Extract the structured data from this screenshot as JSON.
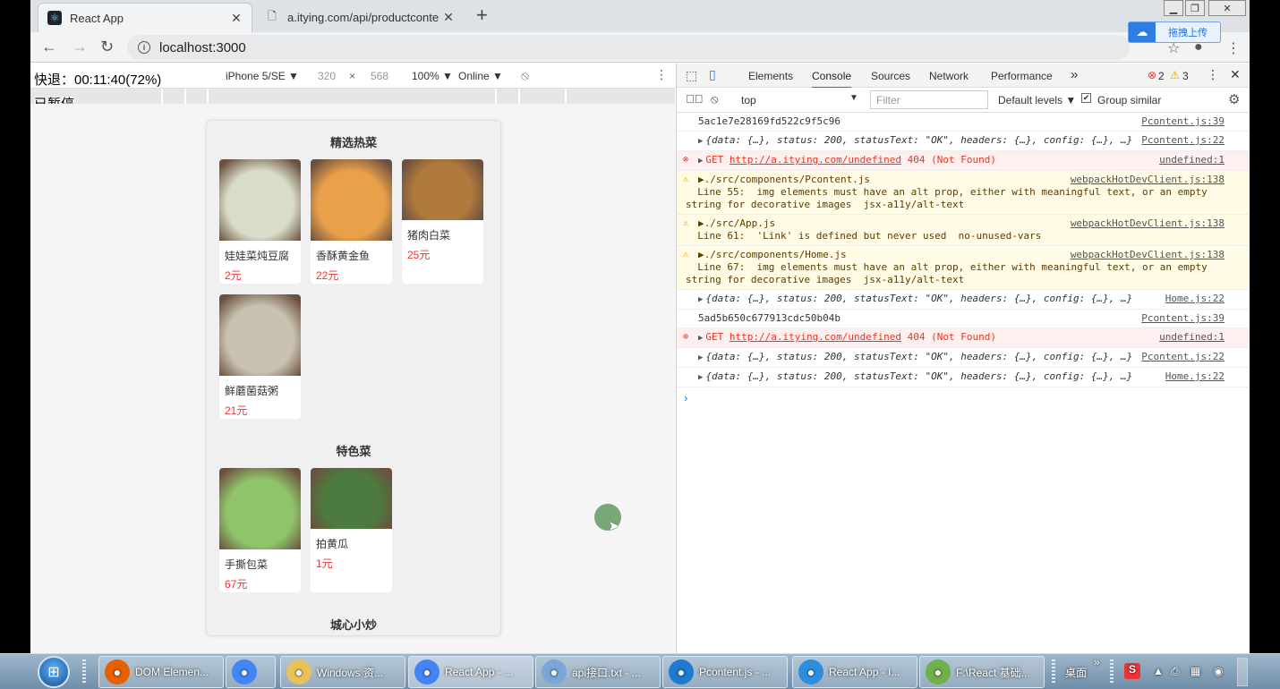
{
  "browser": {
    "tabs": [
      {
        "title": "React App",
        "favicon": "react-icon",
        "active": true
      },
      {
        "title": "a.itying.com/api/productconte",
        "favicon": "page-icon",
        "active": false
      }
    ],
    "url": "localhost:3000",
    "baidu_label": "拖拽上传"
  },
  "overlay": {
    "line1": "快退：00:11:40(72%)",
    "line2": "已暂停"
  },
  "device_toolbar": {
    "device": "iPhone 5/SE ▼",
    "width": "320",
    "times": "×",
    "height": "568",
    "zoom": "100% ▼",
    "network": "Online ▼"
  },
  "app": {
    "categories": [
      {
        "title": "精选热菜",
        "items": [
          {
            "name": "娃娃菜炖豆腐",
            "price": "2元",
            "img_color": "#d8dcc8"
          },
          {
            "name": "香酥黄金鱼",
            "price": "22元",
            "img_color": "#e8a04a"
          },
          {
            "name": "猪肉白菜",
            "price": "25元",
            "img_color": "#b07a3c"
          },
          {
            "name": "鲜蘑菌菇粥",
            "price": "21元",
            "img_color": "#c9c2b0"
          }
        ]
      },
      {
        "title": "特色菜",
        "items": [
          {
            "name": "手撕包菜",
            "price": "67元",
            "img_color": "#8fc46a"
          },
          {
            "name": "拍黄瓜",
            "price": "1元",
            "img_color": "#4d7a3e"
          }
        ]
      },
      {
        "title": "城心小炒",
        "items": []
      }
    ]
  },
  "devtools": {
    "tabs": [
      "Elements",
      "Console",
      "Sources",
      "Network",
      "Performance",
      "»"
    ],
    "selected_tab": "Console",
    "error_count": "2",
    "warn_count": "3",
    "context": "top",
    "filter_placeholder": "Filter",
    "levels": "Default levels ▼",
    "group_similar": "Group similar",
    "logs": [
      {
        "type": "log",
        "text": "5ac1e7e28169fd522c9f5c96",
        "src": "Pcontent.js:39"
      },
      {
        "type": "obj",
        "text": "{data: {…}, status: 200, statusText: \"OK\", headers: {…}, config: {…}, …}",
        "src": "Pcontent.js:22"
      },
      {
        "type": "err",
        "prefix": "GET ",
        "link": "http://a.itying.com/undefined",
        "text": " 404 (Not Found)",
        "src": "undefined:1"
      },
      {
        "type": "warn",
        "text": "▶./src/components/Pcontent.js",
        "text2": "  Line 55:  img elements must have an alt prop, either with meaningful text, or an empty string for decorative images  jsx-a11y/alt-text",
        "src": "webpackHotDevClient.js:138"
      },
      {
        "type": "warn",
        "text": "▶./src/App.js",
        "text2": "  Line 61:  'Link' is defined but never used  no-unused-vars",
        "src": "webpackHotDevClient.js:138"
      },
      {
        "type": "warn",
        "text": "▶./src/components/Home.js",
        "text2": "  Line 67:  img elements must have an alt prop, either with meaningful text, or an empty string for decorative images  jsx-a11y/alt-text",
        "src": "webpackHotDevClient.js:138"
      },
      {
        "type": "obj",
        "text": "{data: {…}, status: 200, statusText: \"OK\", headers: {…}, config: {…}, …}",
        "src": "Home.js:22"
      },
      {
        "type": "log",
        "text": "5ad5b650c677913cdc50b04b",
        "src": "Pcontent.js:39"
      },
      {
        "type": "err",
        "prefix": "GET ",
        "link": "http://a.itying.com/undefined",
        "text": " 404 (Not Found)",
        "src": "undefined:1"
      },
      {
        "type": "obj",
        "text": "{data: {…}, status: 200, statusText: \"OK\", headers: {…}, config: {…}, …}",
        "src": "Pcontent.js:22"
      },
      {
        "type": "obj",
        "text": "{data: {…}, status: 200, statusText: \"OK\", headers: {…}, config: {…}, …}",
        "src": "Home.js:22"
      }
    ]
  },
  "taskbar": {
    "items": [
      {
        "label": "DOM Elemen...",
        "icon": "firefox-icon",
        "color": "#e66000"
      },
      {
        "label": "",
        "icon": "chrome-icon",
        "color": "#4285f4"
      },
      {
        "label": "Windows 资...",
        "icon": "folder-icon",
        "color": "#e8c25a"
      },
      {
        "label": "React App - ...",
        "icon": "chrome-icon",
        "color": "#4285f4"
      },
      {
        "label": "api接口.txt - ...",
        "icon": "notepad-icon",
        "color": "#7aa7d8"
      },
      {
        "label": "Pcontent.js - ...",
        "icon": "vscode-icon",
        "color": "#1f7ad1"
      },
      {
        "label": "React App - I...",
        "icon": "ie-icon",
        "color": "#2d8ee0"
      },
      {
        "label": "F:\\React 基础...",
        "icon": "notepadpp-icon",
        "color": "#6fb04a"
      }
    ],
    "desktop": "桌面"
  }
}
